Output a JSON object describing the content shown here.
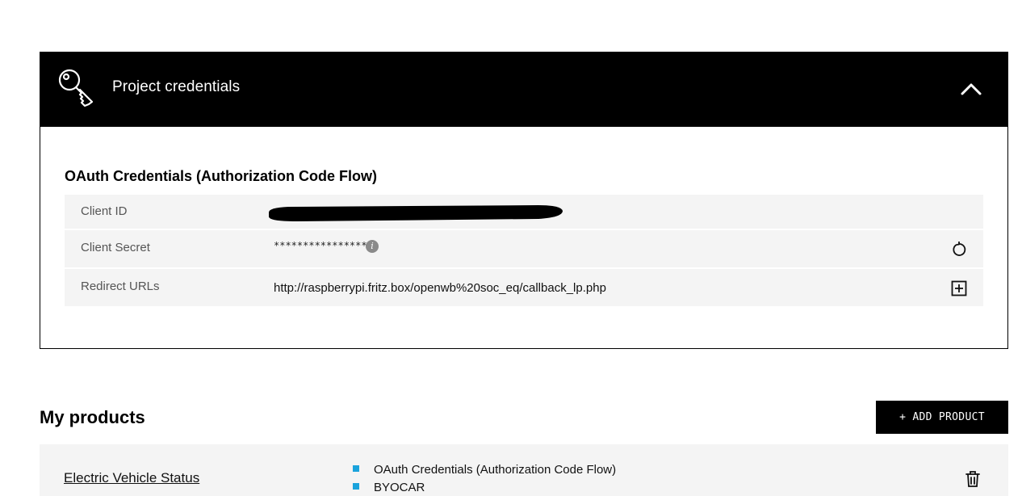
{
  "credentials": {
    "title": "Project credentials",
    "oauth_title": "OAuth Credentials (Authorization Code Flow)",
    "rows": [
      {
        "label": "Client ID",
        "value": ""
      },
      {
        "label": "Client Secret",
        "value": "****************"
      },
      {
        "label": "Redirect URLs",
        "value": "http://raspberrypi.fritz.box/openwb%20soc_eq/callback_lp.php"
      }
    ],
    "icons": {
      "header": "key-icon",
      "collapse": "chevron-up-icon",
      "secret_info": "info-icon",
      "secret_action": "regenerate-icon",
      "redirect_action": "add-url-icon"
    },
    "info_glyph": "i"
  },
  "products": {
    "title": "My products",
    "add_button_label": "+ ADD PRODUCT",
    "items": [
      {
        "name": "Electric Vehicle Status",
        "features": [
          "OAuth Credentials (Authorization Code Flow)",
          "BYOCAR"
        ]
      }
    ],
    "bullet_color": "#1aa3dc"
  },
  "colors": {
    "header_bg": "#000000",
    "row_bg": "#f4f4f4",
    "button_bg": "#000000"
  }
}
